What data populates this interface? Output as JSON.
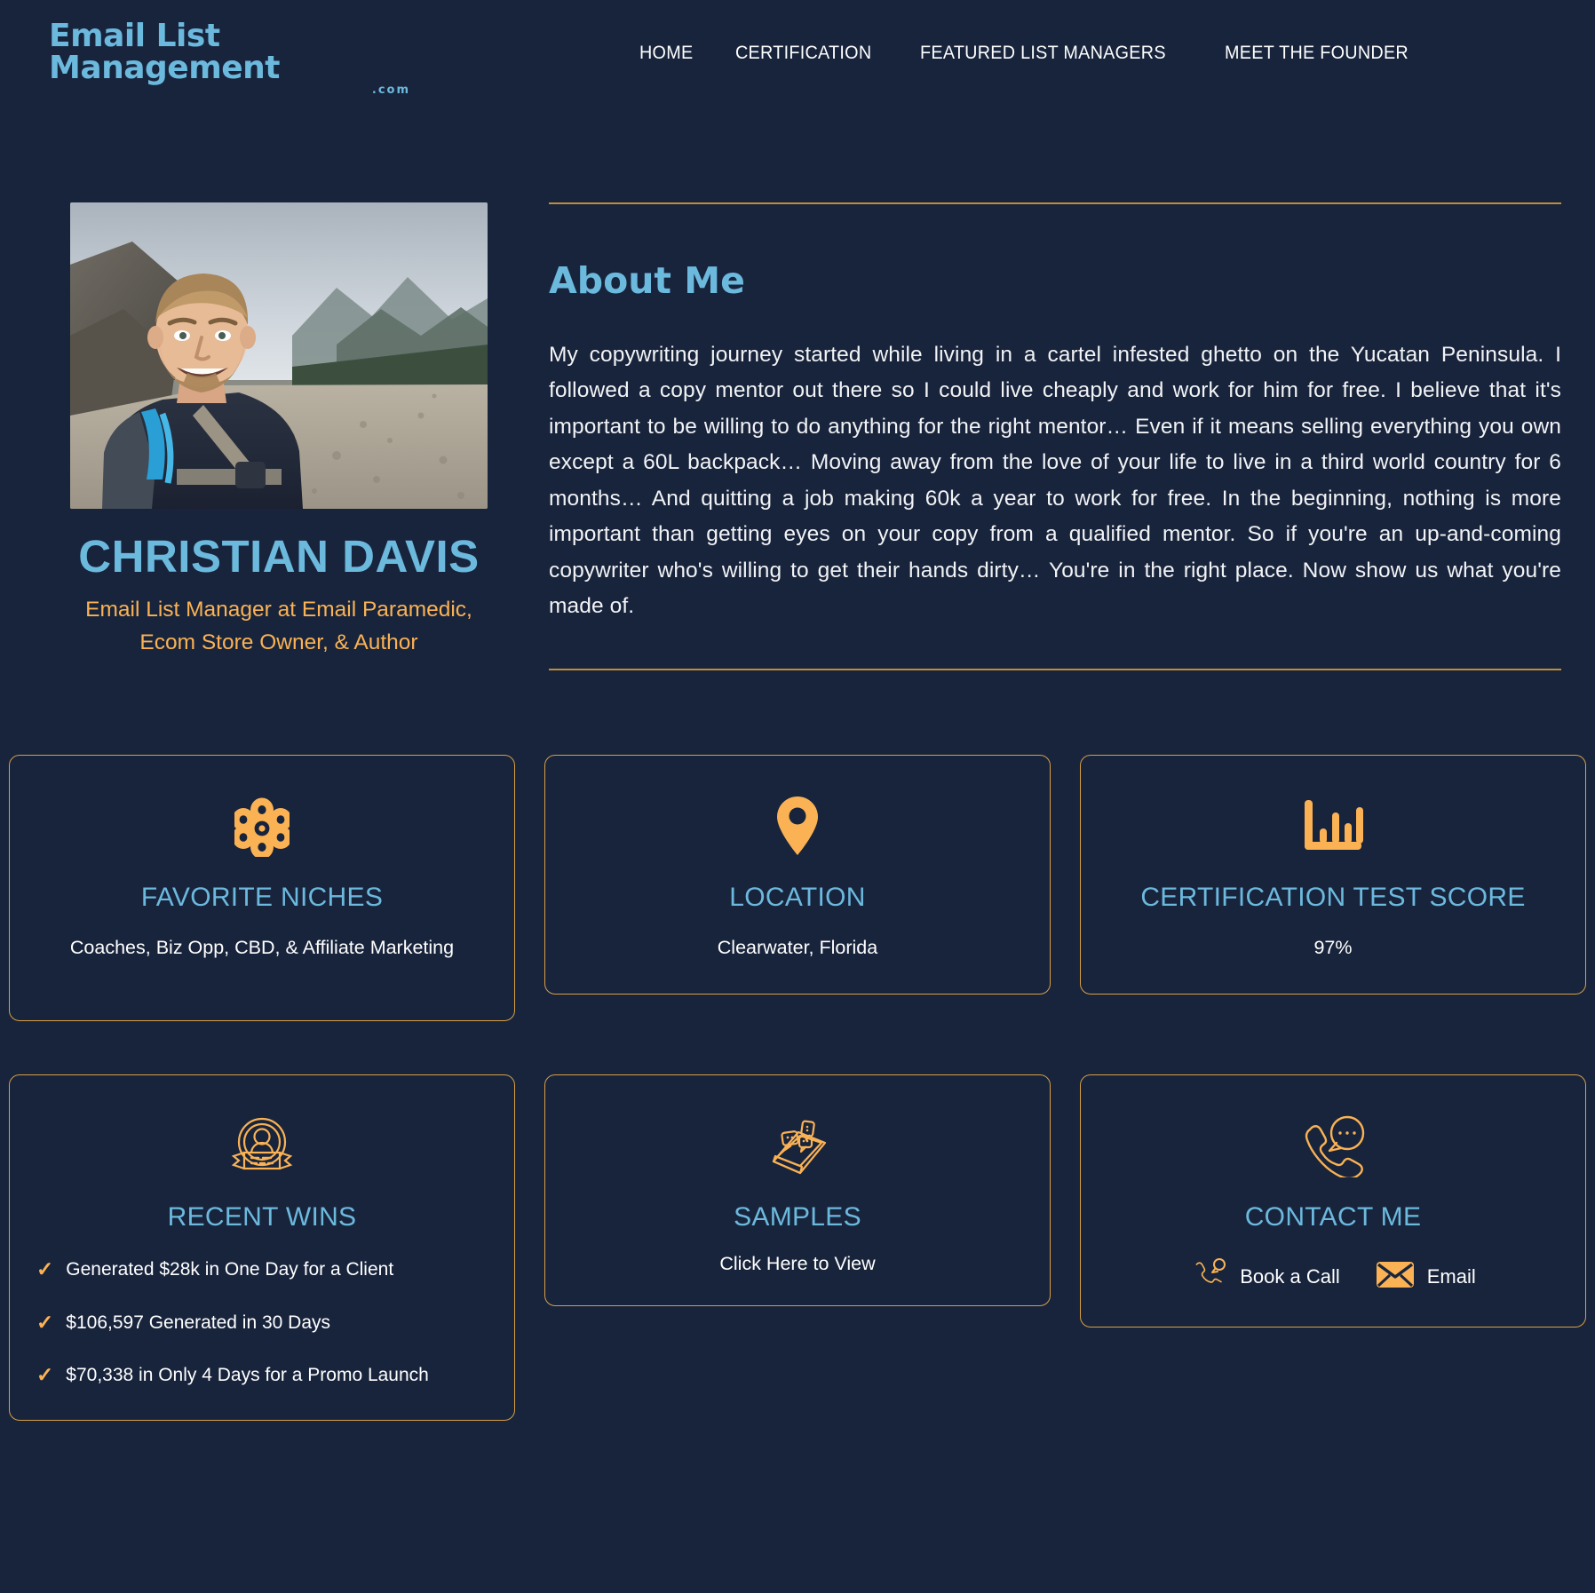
{
  "header": {
    "logo_main": "Email List Management",
    "logo_suffix": ".com",
    "nav": [
      {
        "label": "HOME",
        "name": "nav-home"
      },
      {
        "label": "CERTIFICATION",
        "name": "nav-certification"
      },
      {
        "label": "FEATURED LIST MANAGERS",
        "name": "nav-featured-list-managers"
      },
      {
        "label": "MEET THE FOUNDER",
        "name": "nav-meet-the-founder"
      }
    ]
  },
  "profile": {
    "name": "CHRISTIAN DAVIS",
    "title": "Email List Manager at Email Paramedic, Ecom Store Owner, & Author",
    "photo_alt": "Smiling man with backpack on a mountain trail"
  },
  "about": {
    "heading": "About Me",
    "body": "My copywriting journey started while living in a cartel infested ghetto on the Yucatan Peninsula. I followed a copy mentor out there so I could live cheaply and work for him for free. I believe that it's important to be willing to do anything for the right mentor… Even if it means selling everything you own except a 60L backpack… Moving away from the love of your life to live in a third world country for 6 months… And quitting a job making 60k a year to work for free. In the beginning, nothing is more important than getting eyes on your copy from a qualified mentor. So if you're an up-and-coming copywriter who's willing to get their hands dirty… You're in the right place. Now show us what you're made of."
  },
  "cards": {
    "favorite_niches": {
      "title": "FAVORITE NICHES",
      "value": "Coaches, Biz Opp, CBD, & Affiliate Marketing",
      "icon": "atom-icon"
    },
    "location": {
      "title": "LOCATION",
      "value": "Clearwater, Florida",
      "icon": "map-pin-icon"
    },
    "certification_test_score": {
      "title": "CERTIFICATION TEST SCORE",
      "value": "97%",
      "icon": "bar-chart-icon"
    },
    "recent_wins": {
      "title": "RECENT WINS",
      "icon": "award-badge-icon",
      "items": [
        "Generated $28k in One Day for a Client",
        "$106,597 Generated in 30 Days",
        "$70,338 in Only 4 Days for a Promo Launch"
      ]
    },
    "samples": {
      "title": "SAMPLES",
      "link_label": "Click Here to View",
      "icon": "phone-chat-icon"
    },
    "contact_me": {
      "title": "CONTACT ME",
      "icon": "phone-call-icon",
      "actions": [
        {
          "label": "Book a Call",
          "icon": "phone-handset-icon"
        },
        {
          "label": "Email",
          "icon": "envelope-icon"
        }
      ]
    }
  },
  "colors": {
    "background": "#18243c",
    "accent_blue": "#6cb9de",
    "accent_gold": "#fab254",
    "border_gold": "#d79f45",
    "text_white": "#ffffff"
  }
}
